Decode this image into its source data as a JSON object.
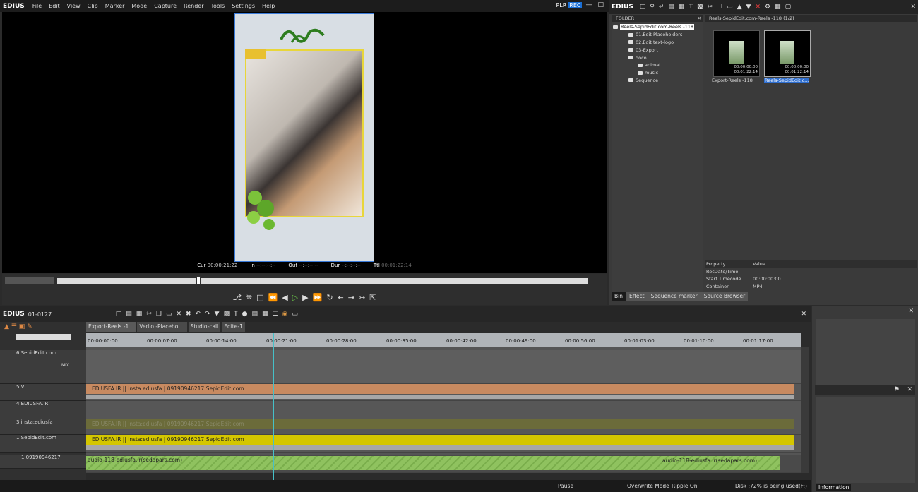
{
  "menubar": {
    "brand": "EDIUS",
    "items": [
      "File",
      "Edit",
      "View",
      "Clip",
      "Marker",
      "Mode",
      "Capture",
      "Render",
      "Tools",
      "Settings",
      "Help"
    ],
    "plr": "PLR",
    "rec": "REC"
  },
  "player": {
    "timecodes": [
      {
        "label": "Cur",
        "value": "00:00:21:22"
      },
      {
        "label": "In",
        "value": "--:--:--:--"
      },
      {
        "label": "Out",
        "value": "--:--:--:--"
      },
      {
        "label": "Dur",
        "value": "--:--:--:--"
      },
      {
        "label": "Ttl",
        "value": "00:01:22:14"
      }
    ]
  },
  "bin": {
    "brand": "EDIUS",
    "folder_header": "FOLDER",
    "tree": [
      {
        "label": "Reels-SepidEdit.com-Reels -118",
        "selected": true,
        "indent": 0
      },
      {
        "label": "01.Edit Placeholders",
        "indent": 1
      },
      {
        "label": "02.Edit text-logo",
        "indent": 1
      },
      {
        "label": "03-Export",
        "indent": 1
      },
      {
        "label": "doco",
        "indent": 1
      },
      {
        "label": "animat",
        "indent": 2
      },
      {
        "label": "music",
        "indent": 2
      },
      {
        "label": "Sequence",
        "indent": 1
      }
    ],
    "bin_header": "Reels-SepidEdit.com-Reels -118 (1/2)",
    "clips": [
      {
        "name": "Export-Reels -118",
        "tc_top": "00:00:00:00",
        "tc_bottom": "00:01:22:14",
        "selected": false
      },
      {
        "name": "Reels-SepidEdit.c...",
        "tc_top": "00:00:00:00",
        "tc_bottom": "00:01:22:14",
        "selected": true
      }
    ],
    "properties_header": {
      "property": "Property",
      "value": "Value"
    },
    "properties": [
      {
        "key": "RecDate/Time",
        "value": ""
      },
      {
        "key": "Start Timecode",
        "value": "00:00:00:00"
      },
      {
        "key": "Container",
        "value": "MP4"
      }
    ],
    "tabs": [
      "Bin",
      "Effect",
      "Sequence marker",
      "Source Browser"
    ]
  },
  "timeline": {
    "brand": "EDIUS",
    "project_code": "01-0127",
    "sequence_tabs": [
      "Export-Reels -1...",
      "Vedio -Placehol...",
      "Studio-call",
      "Edite-1"
    ],
    "ruler": [
      "00:00:00:00",
      "00:00:07:00",
      "00:00:14:00",
      "00:00:21:00",
      "00:00:28:00",
      "00:00:35:00",
      "00:00:42:00",
      "00:00:49:00",
      "00:00:56:00",
      "00:01:03:00",
      "00:01:10:00",
      "00:01:17:00"
    ],
    "tracks": [
      {
        "name": "6 SepidEdit.com",
        "mix": "MIX",
        "clip": ""
      },
      {
        "name": "5 V",
        "clip": "EDIUSFA.IR || insta:ediusfa |  09190946217|SepidEdit.com",
        "color": "#c88a60"
      },
      {
        "name": "4 EDIUSFA.IR",
        "clip": ""
      },
      {
        "name": "3 insta:ediusfa",
        "clip": "EDIUSFA.IR || insta:ediusfa |  09190946217|SepidEdit.com",
        "color": "#6b6b3a"
      },
      {
        "name": "1 SepidEdit.com",
        "clip": "EDIUSFA.IR || insta:ediusfa |  09190946217|SepidEdit.com",
        "color": "#d4c600"
      }
    ],
    "audio_track": {
      "name": "1 09190946217",
      "clip_a": "audio-118-ediusfa.ir(sedapars.com)",
      "clip_b": "audio-118-ediusfa.ir(sedapars.com)"
    }
  },
  "status": {
    "mode": "Pause",
    "overwrite": "Overwrite Mode",
    "ripple": "Ripple On",
    "disk": "Disk :72% is being used(F:)"
  },
  "info": {
    "tab": "Information"
  }
}
